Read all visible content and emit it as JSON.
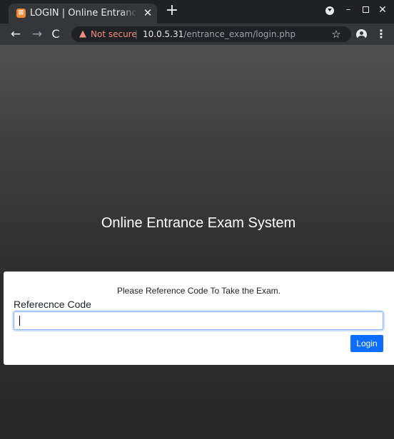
{
  "browser": {
    "tab": {
      "title": "LOGIN | Online Entrance Exam System",
      "favicon_glyph": "⊠",
      "close_glyph": "✕"
    },
    "new_tab_glyph": "+",
    "window_controls": {
      "minimize": "–",
      "close": "✕"
    },
    "nav": {
      "back": "←",
      "forward": "→",
      "reload": "C"
    },
    "address": {
      "warning_glyph": "▲",
      "security_text": "Not secure",
      "separator": "|",
      "host": "10.0.5.31",
      "path": "/entrance_exam/login.php"
    },
    "bookmark_glyph": "☆",
    "menu_glyph": "⋮"
  },
  "page": {
    "heading": "Online Entrance Exam System",
    "prompt": "Please Reference Code To Take the Exam.",
    "field_label": "Referecnce Code",
    "input_value": "",
    "login_button": "Login"
  },
  "colors": {
    "accent": "#0d6efd",
    "warning": "#f28b82",
    "chrome_dark": "#202124",
    "chrome_toolbar": "#35363a"
  }
}
